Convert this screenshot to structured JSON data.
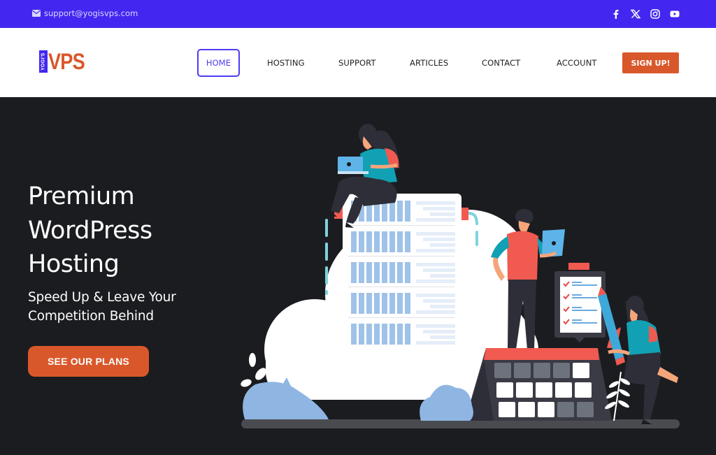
{
  "topbar": {
    "email": "support@yogisvps.com",
    "email_icon": "envelope-icon",
    "social": [
      {
        "name": "facebook",
        "icon": "facebook-icon"
      },
      {
        "name": "x",
        "icon": "x-twitter-icon"
      },
      {
        "name": "instagram",
        "icon": "instagram-icon"
      },
      {
        "name": "youtube",
        "icon": "youtube-icon"
      }
    ]
  },
  "logo": {
    "small": "YOGI'S",
    "main": "VPS"
  },
  "nav": {
    "items": [
      {
        "label": "HOME",
        "active": true
      },
      {
        "label": "HOSTING"
      },
      {
        "label": "SUPPORT"
      },
      {
        "label": "ARTICLES"
      },
      {
        "label": "CONTACT"
      },
      {
        "label": "ACCOUNT"
      }
    ],
    "signup": "SIGN UP!"
  },
  "hero": {
    "title": "Premium WordPress Hosting",
    "subtitle": "Speed Up & Leave Your Competition Behind",
    "cta": "SEE OUR PLANS",
    "illustration": "cloud-server-team-illustration"
  },
  "colors": {
    "topbar": "#4327f0",
    "accent": "#d9582b",
    "active_nav": "#4d3cf5",
    "hero_bg": "#1b1c20"
  }
}
